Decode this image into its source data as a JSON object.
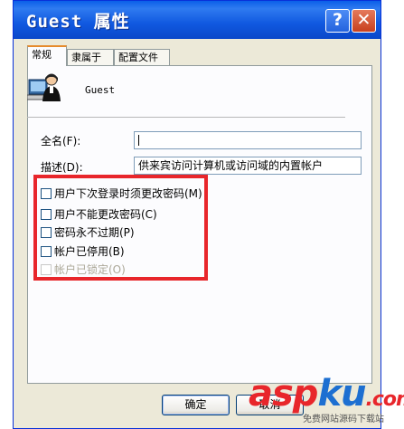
{
  "window": {
    "title": "Guest 属性",
    "help_glyph": "?",
    "close_glyph": "✕"
  },
  "tabs": [
    {
      "label": "常规",
      "active": true
    },
    {
      "label": "隶属于",
      "active": false
    },
    {
      "label": "配置文件",
      "active": false
    }
  ],
  "user": {
    "name": "Guest",
    "icon": "user-account-icon"
  },
  "fields": {
    "fullname_label": "全名(F):",
    "fullname_value": "",
    "description_label": "描述(D):",
    "description_value": "供来宾访问计算机或访问域的内置帐户"
  },
  "options": [
    {
      "label": "用户下次登录时须更改密码(M)",
      "checked": false,
      "enabled": true
    },
    {
      "label": "用户不能更改密码(C)",
      "checked": false,
      "enabled": true
    },
    {
      "label": "密码永不过期(P)",
      "checked": false,
      "enabled": true
    },
    {
      "label": "帐户已停用(B)",
      "checked": false,
      "enabled": true
    },
    {
      "label": "帐户已锁定(O)",
      "checked": false,
      "enabled": false
    }
  ],
  "buttons": {
    "ok": "确定",
    "cancel": "取消"
  },
  "watermark": {
    "brand_a": "asp",
    "brand_b": "ku",
    "brand_c": ".com",
    "tagline": "免费网站源码下载站"
  },
  "colors": {
    "title_blue": "#0a5fe8",
    "highlight_red": "#e8262b",
    "tab_accent": "#e68b2c"
  }
}
